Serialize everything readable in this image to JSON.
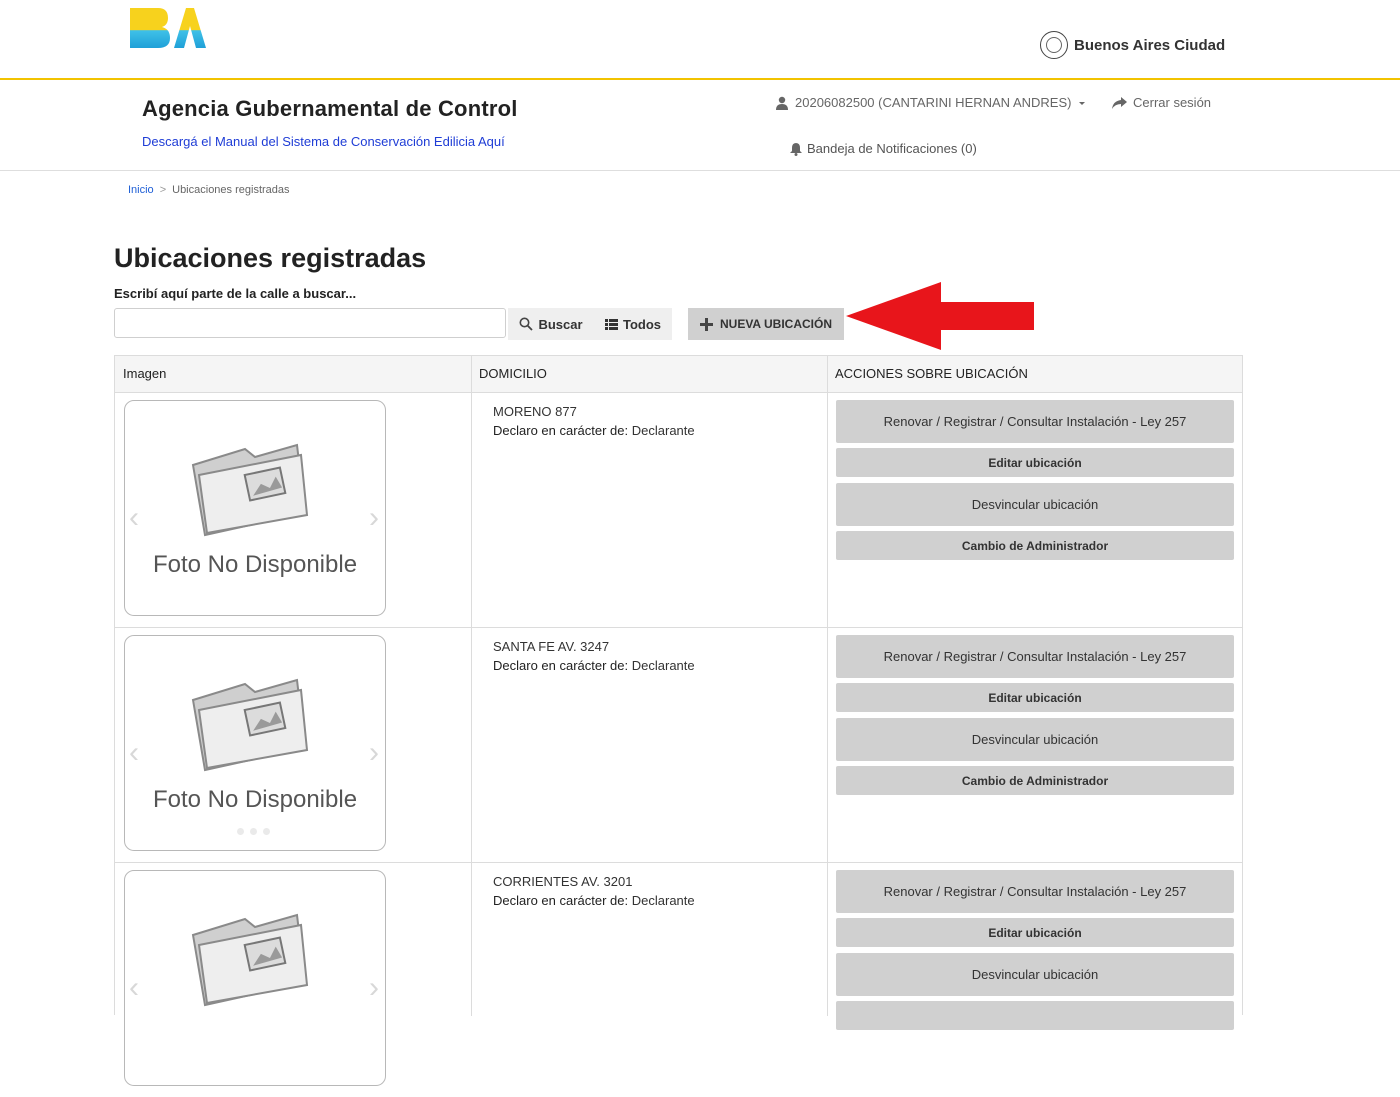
{
  "brand": {
    "logo_text": "BA",
    "city_name": "Buenos Aires Ciudad"
  },
  "header": {
    "agency_title": "Agencia Gubernamental de Control",
    "manual_link": "Descargá el Manual del Sistema de Conservación Edilicia Aquí",
    "user_label": "20206082500 (CANTARINI HERNAN ANDRES)",
    "logout_label": "Cerrar sesión",
    "notifications_label": "Bandeja de Notificaciones (0)"
  },
  "breadcrumb": {
    "home": "Inicio",
    "separator": ">",
    "current": "Ubicaciones registradas"
  },
  "page": {
    "title": "Ubicaciones registradas",
    "search_label": "Escribí aquí parte de la calle a buscar...",
    "search_value": "",
    "buttons": {
      "search": "Buscar",
      "all": "Todos",
      "new_location": "NUEVA UBICACIÓN"
    }
  },
  "table": {
    "columns": [
      "Imagen",
      "DOMICILIO",
      "ACCIONES SOBRE UBICACIÓN"
    ],
    "photo_placeholder": "Foto No Disponible",
    "declare_label": "Declaro en carácter de:",
    "rows": [
      {
        "address": "MORENO 877",
        "role": "Declarante"
      },
      {
        "address": "SANTA FE AV. 3247",
        "role": "Declarante"
      },
      {
        "address": "CORRIENTES AV. 3201",
        "role": "Declarante"
      }
    ],
    "actions": {
      "renew": "Renovar / Registrar / Consultar Instalación - Ley 257",
      "edit": "Editar ubicación",
      "unlink": "Desvincular ubicación",
      "admin_change": "Cambio de Administrador"
    }
  },
  "colors": {
    "accent_yellow": "#f2c300",
    "link_blue": "#1f3dd6",
    "arrow_red": "#e8151b",
    "button_gray": "#d0d0d0"
  }
}
